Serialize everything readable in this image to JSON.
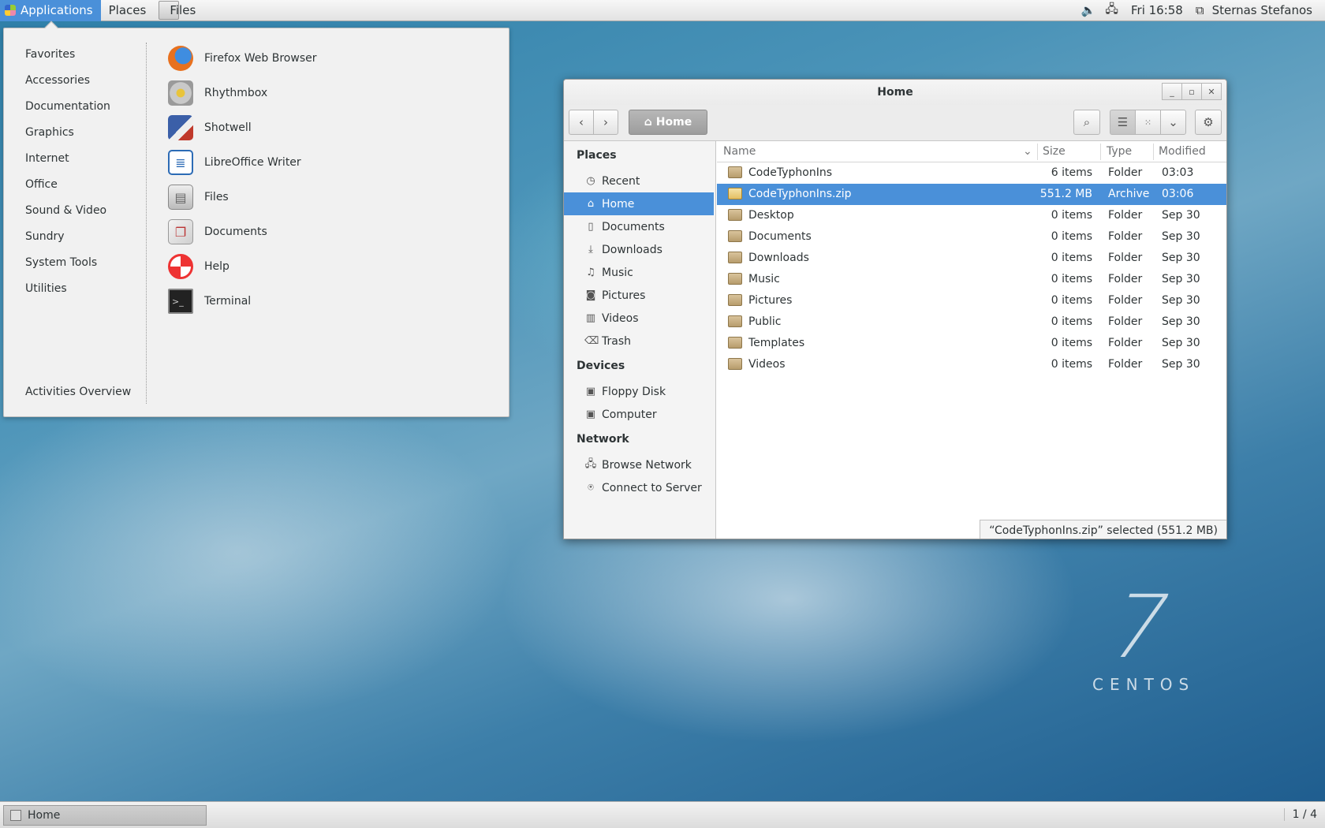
{
  "top_panel": {
    "applications": "Applications",
    "places": "Places",
    "files": "Files",
    "clock": "Fri 16:58",
    "user": "Sternas Stefanos",
    "icons": [
      "volume-icon",
      "network-icon",
      "user-icon"
    ]
  },
  "apps_menu": {
    "categories": [
      "Favorites",
      "Accessories",
      "Documentation",
      "Graphics",
      "Internet",
      "Office",
      "Sound & Video",
      "Sundry",
      "System Tools",
      "Utilities"
    ],
    "activities": "Activities Overview",
    "apps": [
      "Firefox Web Browser",
      "Rhythmbox",
      "Shotwell",
      "LibreOffice Writer",
      "Files",
      "Documents",
      "Help",
      "Terminal"
    ]
  },
  "file_manager": {
    "title": "Home",
    "location": "Home",
    "sidebar": {
      "places_header": "Places",
      "places": [
        "Recent",
        "Home",
        "Documents",
        "Downloads",
        "Music",
        "Pictures",
        "Videos",
        "Trash"
      ],
      "selected": "Home",
      "devices_header": "Devices",
      "devices": [
        "Floppy Disk",
        "Computer"
      ],
      "network_header": "Network",
      "network": [
        "Browse Network",
        "Connect to Server"
      ]
    },
    "columns": {
      "name": "Name",
      "size": "Size",
      "type": "Type",
      "modified": "Modified"
    },
    "rows": [
      {
        "name": "CodeTyphonIns",
        "size": "6 items",
        "type": "Folder",
        "modified": "03:03"
      },
      {
        "name": "CodeTyphonIns.zip",
        "size": "551.2 MB",
        "type": "Archive",
        "modified": "03:06"
      },
      {
        "name": "Desktop",
        "size": "0 items",
        "type": "Folder",
        "modified": "Sep 30"
      },
      {
        "name": "Documents",
        "size": "0 items",
        "type": "Folder",
        "modified": "Sep 30"
      },
      {
        "name": "Downloads",
        "size": "0 items",
        "type": "Folder",
        "modified": "Sep 30"
      },
      {
        "name": "Music",
        "size": "0 items",
        "type": "Folder",
        "modified": "Sep 30"
      },
      {
        "name": "Pictures",
        "size": "0 items",
        "type": "Folder",
        "modified": "Sep 30"
      },
      {
        "name": "Public",
        "size": "0 items",
        "type": "Folder",
        "modified": "Sep 30"
      },
      {
        "name": "Templates",
        "size": "0 items",
        "type": "Folder",
        "modified": "Sep 30"
      },
      {
        "name": "Videos",
        "size": "0 items",
        "type": "Folder",
        "modified": "Sep 30"
      }
    ],
    "selected_row": "CodeTyphonIns.zip",
    "status": "“CodeTyphonIns.zip” selected  (551.2 MB)"
  },
  "desktop": {
    "version": "7",
    "brand": "CENTOS"
  },
  "bottom_panel": {
    "task": "Home",
    "workspace": "1 / 4"
  }
}
